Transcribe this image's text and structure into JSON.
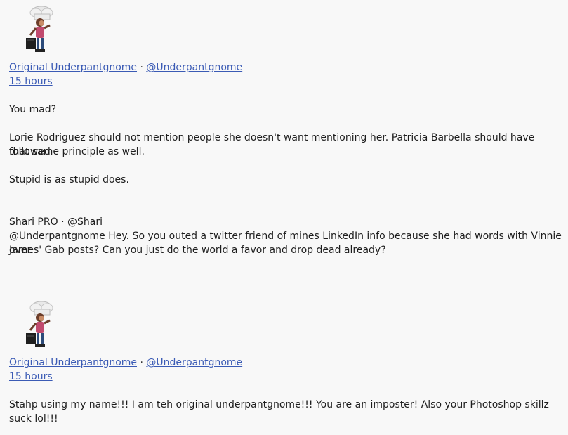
{
  "post1": {
    "author_name": "Original Underpantgnome",
    "separator": " · ",
    "author_handle": "@Underpantgnome",
    "timestamp": "15 hours",
    "text_line1": "You mad?",
    "text_line2": "Lorie Rodriguez should not mention people she doesn't want mentioning her. Patricia Barbella should have followed",
    "text_line3": "that same principle as well.",
    "text_line4": "Stupid is as stupid does."
  },
  "quoted": {
    "author": "Shari PRO · @Shari",
    "line1": "@Underpantgnome Hey. So you outed a twitter friend of mines LinkedIn info because she had words with Vinnie over",
    "line2": "James' Gab posts? Can you just do the world a favor and drop dead already?"
  },
  "post2": {
    "author_name": "Original Underpantgnome",
    "separator": " · ",
    "author_handle": "@Underpantgnome",
    "timestamp": "15 hours",
    "text_line1": "Stahp using my name!!! I am teh original underpantgnome!!! You are an imposter! Also your Photoshop skillz suck lol!!!"
  },
  "icons": {
    "avatar": "chef-gnome-avatar-icon"
  },
  "colors": {
    "link": "#3b5bb5",
    "background": "#f8f8f8",
    "text": "#1e1e1e"
  }
}
